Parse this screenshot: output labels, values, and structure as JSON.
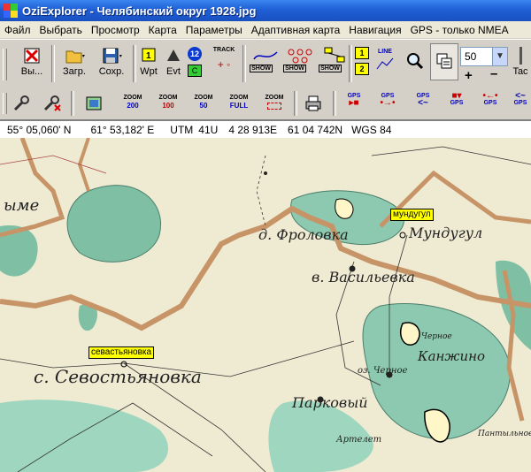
{
  "window": {
    "title": "OziExplorer - Челябинский округ 1928.jpg"
  },
  "menu": [
    "Файл",
    "Выбрать",
    "Просмотр",
    "Карта",
    "Параметры",
    "Адаптивная карта",
    "Навигация",
    "GPS - только NMEA"
  ],
  "toolbar": {
    "exit_label": "Вы...",
    "load_label": "Загр.",
    "save_label": "Сохр.",
    "wpt_label": "Wpt",
    "evt_label": "Evt",
    "count_badge": "12",
    "track_label": "TRACK",
    "show_label": "SHOW",
    "line_label": "LINE",
    "zoom_value": "50",
    "plus": "+",
    "minus": "–",
    "last_label": "Tac"
  },
  "toolbar2": {
    "zoom_prefix": "ZOOM",
    "zooms": [
      "200",
      "100",
      "50",
      "FULL"
    ],
    "gps_label": "GPS"
  },
  "status": {
    "lat": "55° 05,060' N",
    "lon": "61° 53,182' E",
    "utm_label": "UTM",
    "utm_zone": "41U",
    "easting": "4 28 913E",
    "northing": "61 04 742N",
    "datum": "WGS 84"
  },
  "map": {
    "waypoints": [
      "мундугул",
      "севастьяновка"
    ],
    "labels": [
      "д. Фроловка",
      "Мундугул",
      "в. Васильевка",
      "с. Севостьяновка",
      "Канжино",
      "оз. Черное",
      "Парковый",
      "Пантыльное",
      "Артелет",
      "Черное",
      "ыме"
    ]
  },
  "colors": {
    "title_bar": "#1f5fd6",
    "map_bg": "#efead2",
    "forest": "#7fbfa4",
    "road": "#c79468",
    "waypoint": "#ffff00"
  }
}
